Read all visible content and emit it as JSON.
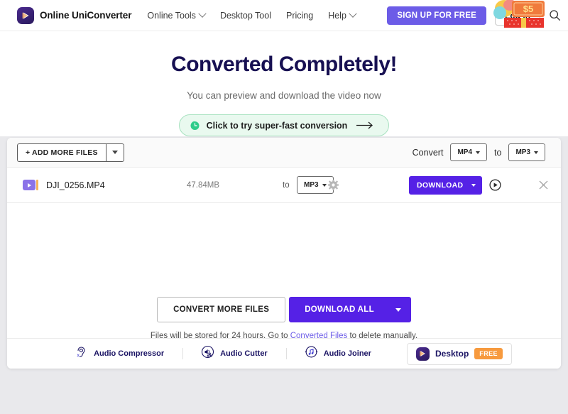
{
  "header": {
    "brand": "Online UniConverter",
    "nav": [
      {
        "label": "Online Tools",
        "has_caret": true
      },
      {
        "label": "Desktop Tool",
        "has_caret": false
      },
      {
        "label": "Pricing",
        "has_caret": false
      },
      {
        "label": "Help",
        "has_caret": true
      }
    ],
    "signup_label": "SIGN UP FOR FREE",
    "login_label": "Log In",
    "search_icon": "search-icon",
    "promo_amount": "$5",
    "accent_purple": "#6c5ce7"
  },
  "hero": {
    "title": "Converted Completely!",
    "subtitle": "You can preview and download the video now",
    "fast_pill": "Click to try super-fast conversion",
    "pill_bg": "#e9f9ef",
    "title_color": "#171052"
  },
  "toolbar": {
    "add_files_label": "+ ADD MORE FILES",
    "convert_label": "Convert",
    "source_format": "MP4",
    "to_label": "to",
    "target_format": "MP3"
  },
  "file_row": {
    "name": "DJI_0256.MP4",
    "size": "47.84MB",
    "to_label": "to",
    "output_format": "MP3",
    "download_label": "DOWNLOAD",
    "settings_icon": "gear-icon",
    "preview_icon": "play-circle-icon",
    "remove_icon": "close-icon",
    "download_color": "#5521e6"
  },
  "actions": {
    "convert_more_label": "CONVERT MORE FILES",
    "download_all_label": "DOWNLOAD ALL",
    "note_prefix": "Files will be stored for 24 hours. Go to ",
    "note_link": "Converted Files",
    "note_suffix": " to delete manually."
  },
  "footer_tools": [
    {
      "label": "Audio Compressor",
      "icon": "ear-compressor-icon"
    },
    {
      "label": "Audio Cutter",
      "icon": "speaker-scissors-icon"
    },
    {
      "label": "Audio Joiner",
      "icon": "music-note-circle-icon"
    }
  ],
  "desktop_promo": {
    "label": "Desktop",
    "badge": "FREE",
    "badge_color": "#f79a3e"
  }
}
